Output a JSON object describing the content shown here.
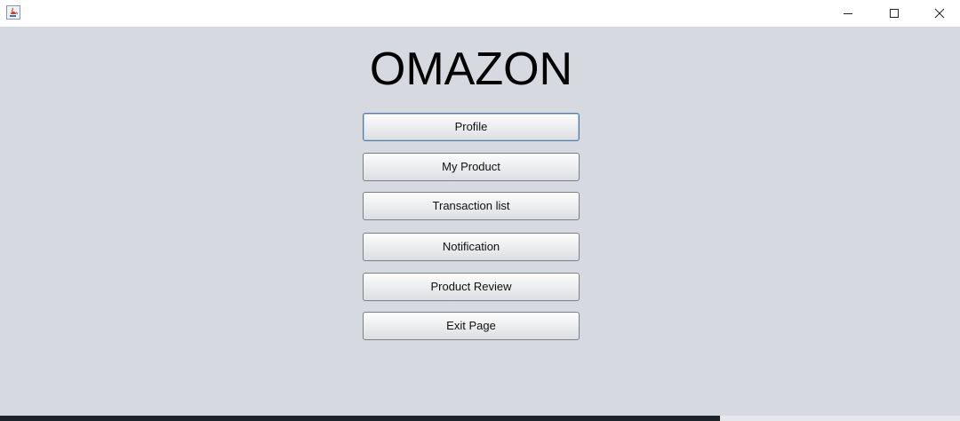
{
  "window": {
    "app_icon": "java-coffee-icon",
    "controls": {
      "minimize_icon": "minimize-icon",
      "maximize_icon": "maximize-icon",
      "close_icon": "close-icon"
    }
  },
  "main": {
    "title": "OMAZON",
    "menu": [
      {
        "label": "Profile"
      },
      {
        "label": "My Product"
      },
      {
        "label": "Transaction list"
      },
      {
        "label": "Notification"
      },
      {
        "label": "Product Review"
      },
      {
        "label": "Exit Page"
      }
    ]
  },
  "colors": {
    "background": "#d6d9e0",
    "titlebar": "#ffffff",
    "button_border": "#7a8088",
    "focus_border": "#5a7ca4"
  }
}
